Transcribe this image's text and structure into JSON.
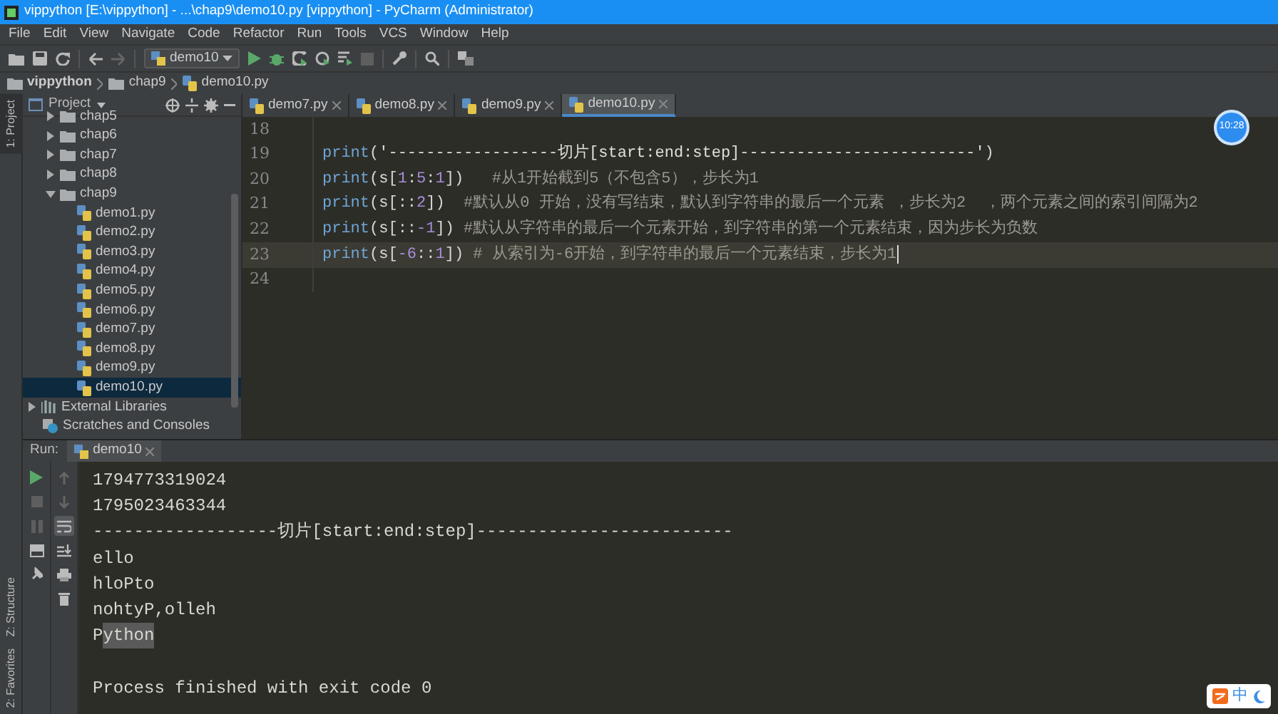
{
  "window": {
    "title": "vippython [E:\\vippython] - ...\\chap9\\demo10.py [vippython] - PyCharm (Administrator)"
  },
  "menu": [
    "File",
    "Edit",
    "View",
    "Navigate",
    "Code",
    "Refactor",
    "Run",
    "Tools",
    "VCS",
    "Window",
    "Help"
  ],
  "toolbar": {
    "run_config": "demo10",
    "forward_enabled": false,
    "stop_enabled": false
  },
  "breadcrumb": [
    {
      "label": "vippython",
      "kind": "folder"
    },
    {
      "label": "chap9",
      "kind": "folder"
    },
    {
      "label": "demo10.py",
      "kind": "file"
    }
  ],
  "side_tabs": [
    {
      "label": "1: Project",
      "selected": true
    },
    {
      "label": "Z: Structure",
      "selected": false
    },
    {
      "label": "2: Favorites",
      "selected": false
    }
  ],
  "project_panel": {
    "title": "Project",
    "module_children": [
      {
        "label": "chap5",
        "expanded": false
      },
      {
        "label": "chap6",
        "expanded": false
      },
      {
        "label": "chap7",
        "expanded": false
      },
      {
        "label": "chap8",
        "expanded": false
      },
      {
        "label": "chap9",
        "expanded": true,
        "children": [
          {
            "label": "demo1.py",
            "selected": false
          },
          {
            "label": "demo2.py",
            "selected": false
          },
          {
            "label": "demo3.py",
            "selected": false
          },
          {
            "label": "demo4.py",
            "selected": false
          },
          {
            "label": "demo5.py",
            "selected": false
          },
          {
            "label": "demo6.py",
            "selected": false
          },
          {
            "label": "demo7.py",
            "selected": false
          },
          {
            "label": "demo8.py",
            "selected": false
          },
          {
            "label": "demo9.py",
            "selected": false
          },
          {
            "label": "demo10.py",
            "selected": true
          }
        ]
      }
    ],
    "roots": [
      {
        "label": "External Libraries",
        "kind": "library",
        "expanded": false
      },
      {
        "label": "Scratches and Consoles",
        "kind": "scratches"
      }
    ]
  },
  "editor_tabs": [
    {
      "label": "demo7.py",
      "selected": false
    },
    {
      "label": "demo8.py",
      "selected": false
    },
    {
      "label": "demo9.py",
      "selected": false
    },
    {
      "label": "demo10.py",
      "selected": true
    }
  ],
  "code_lines": [
    {
      "number": "18",
      "current": false
    },
    {
      "number": "19",
      "current": false,
      "tokens": [
        {
          "text": "print",
          "kind": "func"
        },
        {
          "text": "(",
          "kind": "punct"
        },
        {
          "text": "'------------------切片[start:end:step]-------------------------'",
          "kind": "str"
        },
        {
          "text": ")",
          "kind": "punct"
        }
      ]
    },
    {
      "number": "20",
      "current": false,
      "tokens": [
        {
          "text": "print",
          "kind": "func"
        },
        {
          "text": "(s[",
          "kind": "punct"
        },
        {
          "text": "1",
          "kind": "num"
        },
        {
          "text": ":",
          "kind": "punct"
        },
        {
          "text": "5",
          "kind": "num"
        },
        {
          "text": ":",
          "kind": "punct"
        },
        {
          "text": "1",
          "kind": "num"
        },
        {
          "text": "])",
          "kind": "punct"
        },
        {
          "text": "   #从1开始截到5（不包含5），步长为1",
          "kind": "comment"
        }
      ]
    },
    {
      "number": "21",
      "current": false,
      "tokens": [
        {
          "text": "print",
          "kind": "func"
        },
        {
          "text": "(s[::",
          "kind": "punct"
        },
        {
          "text": "2",
          "kind": "num"
        },
        {
          "text": "])",
          "kind": "punct"
        },
        {
          "text": "  #默认从0 开始，没有写结束，默认到字符串的最后一个元素 ，步长为2  ，两个元素之间的索引间隔为2",
          "kind": "comment"
        }
      ]
    },
    {
      "number": "22",
      "current": false,
      "tokens": [
        {
          "text": "print",
          "kind": "func"
        },
        {
          "text": "(s[::",
          "kind": "punct"
        },
        {
          "text": "-1",
          "kind": "num"
        },
        {
          "text": "])",
          "kind": "punct"
        },
        {
          "text": " #默认从字符串的最后一个元素开始，到字符串的第一个元素结束，因为步长为负数",
          "kind": "comment"
        }
      ]
    },
    {
      "number": "23",
      "current": true,
      "tokens": [
        {
          "text": "print",
          "kind": "func"
        },
        {
          "text": "(s[",
          "kind": "punct"
        },
        {
          "text": "-6",
          "kind": "num"
        },
        {
          "text": "::",
          "kind": "punct"
        },
        {
          "text": "1",
          "kind": "num"
        },
        {
          "text": "])",
          "kind": "punct"
        },
        {
          "text": " # 从索引为-6开始，到字符串的最后一个元素结束，步长为1",
          "kind": "comment"
        }
      ]
    },
    {
      "number": "24",
      "current": false
    }
  ],
  "timer_badge": "10:28",
  "run_panel": {
    "label": "Run:",
    "tab": "demo10",
    "soft_wrap_on": true,
    "rerun_enabled": true,
    "stop_enabled": false,
    "lines": [
      {
        "kind": "output",
        "segments": [
          {
            "text": "1794773319024",
            "selected": false
          }
        ]
      },
      {
        "kind": "output",
        "segments": [
          {
            "text": "1795023463344",
            "selected": false
          }
        ]
      },
      {
        "kind": "output",
        "segments": [
          {
            "text": "------------------切片[start:end:step]-------------------------",
            "selected": false
          }
        ]
      },
      {
        "kind": "output",
        "segments": [
          {
            "text": "ello",
            "selected": false
          }
        ]
      },
      {
        "kind": "output",
        "segments": [
          {
            "text": "hloPto",
            "selected": false
          }
        ]
      },
      {
        "kind": "output",
        "segments": [
          {
            "text": "nohtyP,olleh",
            "selected": false
          }
        ]
      },
      {
        "kind": "output",
        "segments": [
          {
            "text": "P",
            "selected": false
          },
          {
            "text": "ython",
            "selected": true
          }
        ]
      },
      {
        "kind": "status",
        "segments": [
          {
            "text": "Process finished with exit code 0",
            "selected": false
          }
        ]
      }
    ]
  },
  "ime_toolbar": {
    "mode": "中"
  }
}
